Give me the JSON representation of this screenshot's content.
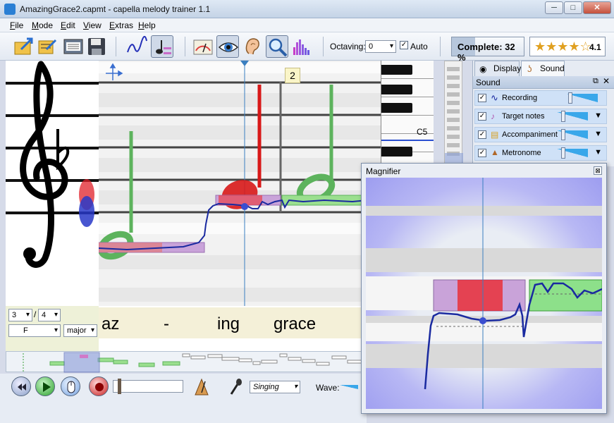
{
  "window": {
    "title": "AmazingGrace2.capmt - capella melody trainer 1.1",
    "minimize_glyph": "─",
    "maximize_glyph": "□",
    "close_glyph": "✕"
  },
  "menu": [
    "File",
    "Mode",
    "Edit",
    "View",
    "Extras",
    "Help"
  ],
  "toolbar": {
    "octaving_label": "Octaving:",
    "octaving_value": "0",
    "auto_label": "Auto",
    "complete_text": "Complete: 32 %",
    "rating_stars": "★★★★☆",
    "rating_value": "4.1"
  },
  "score": {
    "measure_number": "2",
    "piano_label": "C5",
    "time_sig_num": "3",
    "time_sig_den": "4",
    "key": "F",
    "mode": "major",
    "lyrics": [
      "az",
      "-",
      "ing",
      "grace"
    ]
  },
  "panel": {
    "tabs": [
      "Display",
      "Sound"
    ],
    "section_title": "Sound",
    "rows": [
      {
        "label": "Recording",
        "checked": true
      },
      {
        "label": "Target notes",
        "checked": true
      },
      {
        "label": "Accompaniment",
        "checked": true
      },
      {
        "label": "Metronome",
        "checked": true
      }
    ]
  },
  "bottom": {
    "singing_value": "Singing",
    "wave_label": "Wave:"
  },
  "magnifier": {
    "title": "Magnifier",
    "close_glyph": "⊠"
  },
  "colors": {
    "target_note": "#5db35d",
    "sung_note": "#d81818",
    "pitch_curve": "#1a2aa0",
    "accent": "#39a7ea"
  }
}
